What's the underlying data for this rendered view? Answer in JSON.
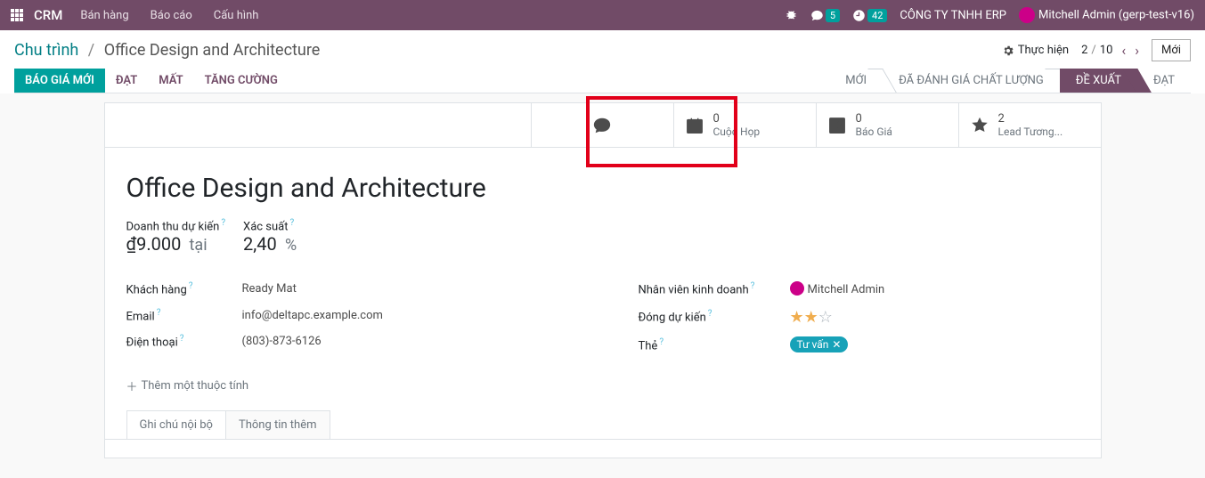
{
  "nav": {
    "brand": "CRM",
    "links": [
      "Bán hàng",
      "Báo cáo",
      "Cấu hình"
    ],
    "msg_count": "5",
    "activity_count": "42",
    "company": "CÔNG TY TNHH ERP",
    "user": "Mitchell Admin (gerp-test-v16)"
  },
  "breadcrumb": {
    "root": "Chu trình",
    "current": "Office Design and Architecture"
  },
  "cog_label": "Thực hiện",
  "pager": {
    "pos": "2",
    "sep": "/",
    "total": "10"
  },
  "btn_new": "Mới",
  "actions": {
    "quote": "BÁO GIÁ MỚI",
    "won": "ĐẠT",
    "lost": "MẤT",
    "boost": "TĂNG CƯỜNG"
  },
  "stages": [
    "MỚI",
    "ĐÃ ĐÁNH GIÁ CHẤT LƯỢNG",
    "ĐỀ XUẤT",
    "ĐẠT"
  ],
  "active_stage": 2,
  "stat": {
    "meeting_n": "0",
    "meeting_l": "Cuộc Họp",
    "quote_n": "0",
    "quote_l": "Báo Giá",
    "lead_n": "2",
    "lead_l": "Lead Tương..."
  },
  "record": {
    "title": "Office Design and Architecture",
    "rev_label": "Doanh thu dự kiến",
    "rev_val": "₫9.000",
    "at": "tại",
    "prob_label": "Xác suất",
    "prob_val": "2,40",
    "pct": "%",
    "cust_label": "Khách hàng",
    "cust_val": "Ready Mat",
    "email_label": "Email",
    "email_val": "info@deltapc.example.com",
    "phone_label": "Điện thoại",
    "phone_val": "(803)-873-6126",
    "sales_label": "Nhân viên kinh doanh",
    "sales_val": "Mitchell Admin",
    "close_label": "Đóng dự kiến",
    "tag_label": "Thẻ",
    "tag_val": "Tư vấn",
    "add_prop": "Thêm một thuộc tính"
  },
  "tabs": [
    "Ghi chú nội bộ",
    "Thông tin thêm"
  ]
}
